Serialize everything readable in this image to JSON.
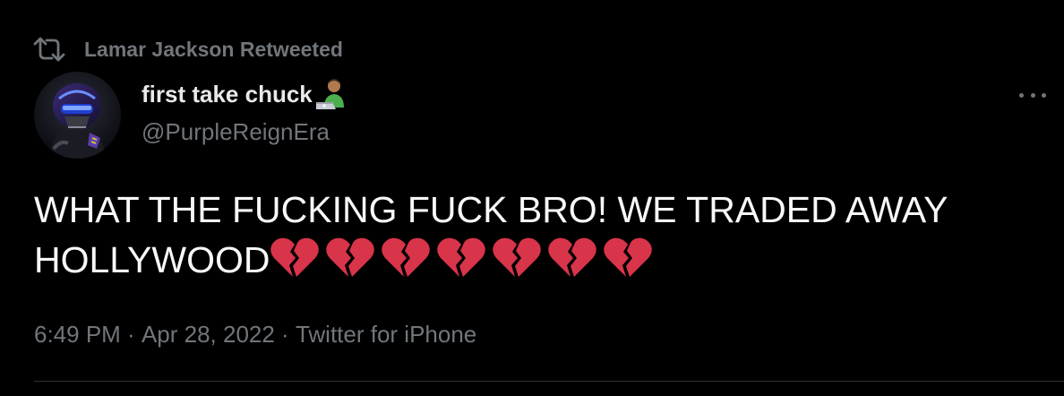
{
  "retweet": {
    "icon": "retweet-icon",
    "label": "Lamar Jackson Retweeted"
  },
  "author": {
    "display_name": "first take chuck",
    "name_emoji": "man-technologist-emoji",
    "handle": "@PurpleReignEra",
    "avatar": "football-player-avatar"
  },
  "tweet": {
    "text": "WHAT THE FUCKING FUCK BRO! WE TRADED AWAY\nHOLLYWOOD",
    "emoji": "broken-heart-emoji",
    "emoji_count": 7
  },
  "meta": {
    "time": "6:49 PM",
    "separator": " · ",
    "date": "Apr 28, 2022",
    "source": "Twitter for iPhone"
  },
  "more_icon": "more-icon",
  "colors": {
    "background": "#000000",
    "primary_text": "#e7e9ea",
    "secondary_text": "#71767b",
    "divider": "#2f3336",
    "heart": "#d8344a"
  }
}
